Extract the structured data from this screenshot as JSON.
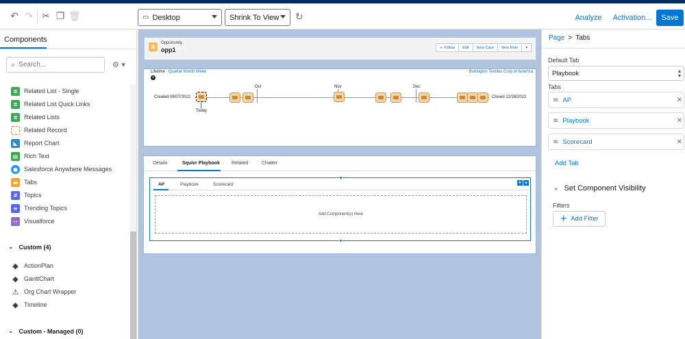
{
  "toolbar": {
    "device_select": "Desktop",
    "zoom_select": "Shrink To View",
    "analyze": "Analyze",
    "activation": "Activation...",
    "save": "Save"
  },
  "left_panel": {
    "tab_label": "Components",
    "search_placeholder": "Search...",
    "components": [
      {
        "label": "Related List - Single",
        "icon": "related-list-icon",
        "color": "#3ba755"
      },
      {
        "label": "Related List Quick Links",
        "icon": "quick-links-icon",
        "color": "#3ba755"
      },
      {
        "label": "Related Lists",
        "icon": "related-lists-icon",
        "color": "#3ba755"
      },
      {
        "label": "Related Record",
        "icon": "related-record-icon",
        "color": "#e8734b"
      },
      {
        "label": "Report Chart",
        "icon": "report-chart-icon",
        "color": "#2e8bc0"
      },
      {
        "label": "Rich Text",
        "icon": "rich-text-icon",
        "color": "#3ba755"
      },
      {
        "label": "Salesforce Anywhere Messages",
        "icon": "messages-icon",
        "color": "#1b96ff"
      },
      {
        "label": "Tabs",
        "icon": "tabs-icon",
        "color": "#f6a23a"
      },
      {
        "label": "Topics",
        "icon": "topics-icon",
        "color": "#5867e8"
      },
      {
        "label": "Trending Topics",
        "icon": "trending-topics-icon",
        "color": "#5867e8"
      },
      {
        "label": "Visualforce",
        "icon": "visualforce-icon",
        "color": "#8b6fc4"
      }
    ],
    "custom_header": "Custom (4)",
    "custom_items": [
      "ActionPlan",
      "GanttChart",
      "Org Chart Wrapper",
      "Timeline"
    ],
    "custom_managed_header": "Custom - Managed (0)"
  },
  "canvas": {
    "record_type": "Opportunity",
    "record_name": "opp1",
    "header_buttons": [
      "Follow",
      "Edit",
      "New Case",
      "New Note"
    ],
    "timeline": {
      "lifetime_label": "Lifetime",
      "scales": "Quarter Month Week",
      "account_link": "Burlington Textiles Corp of America",
      "created_label": "Created 09/07/2022",
      "closed_label": "Closed 12/28/2022",
      "today_label": "Today",
      "months": [
        "Oct",
        "Nov",
        "Dec"
      ]
    },
    "record_tabs": [
      "Details",
      "Squivr Playbook",
      "Related",
      "Chatter"
    ],
    "inner_tabs": [
      "AP",
      "Playbook",
      "Scorecard"
    ],
    "dropzone_text": "Add Component(s) Here"
  },
  "right_panel": {
    "breadcrumb_page": "Page",
    "breadcrumb_sep": ">",
    "breadcrumb_current": "Tabs",
    "default_tab_label": "Default Tab",
    "default_tab_value": "Playbook",
    "tabs_label": "Tabs",
    "tabs": [
      "AP",
      "Playbook",
      "Scorecard"
    ],
    "add_tab": "Add Tab",
    "visibility_header": "Set Component Visibility",
    "filters_label": "Filters",
    "add_filter": "Add Filter"
  }
}
